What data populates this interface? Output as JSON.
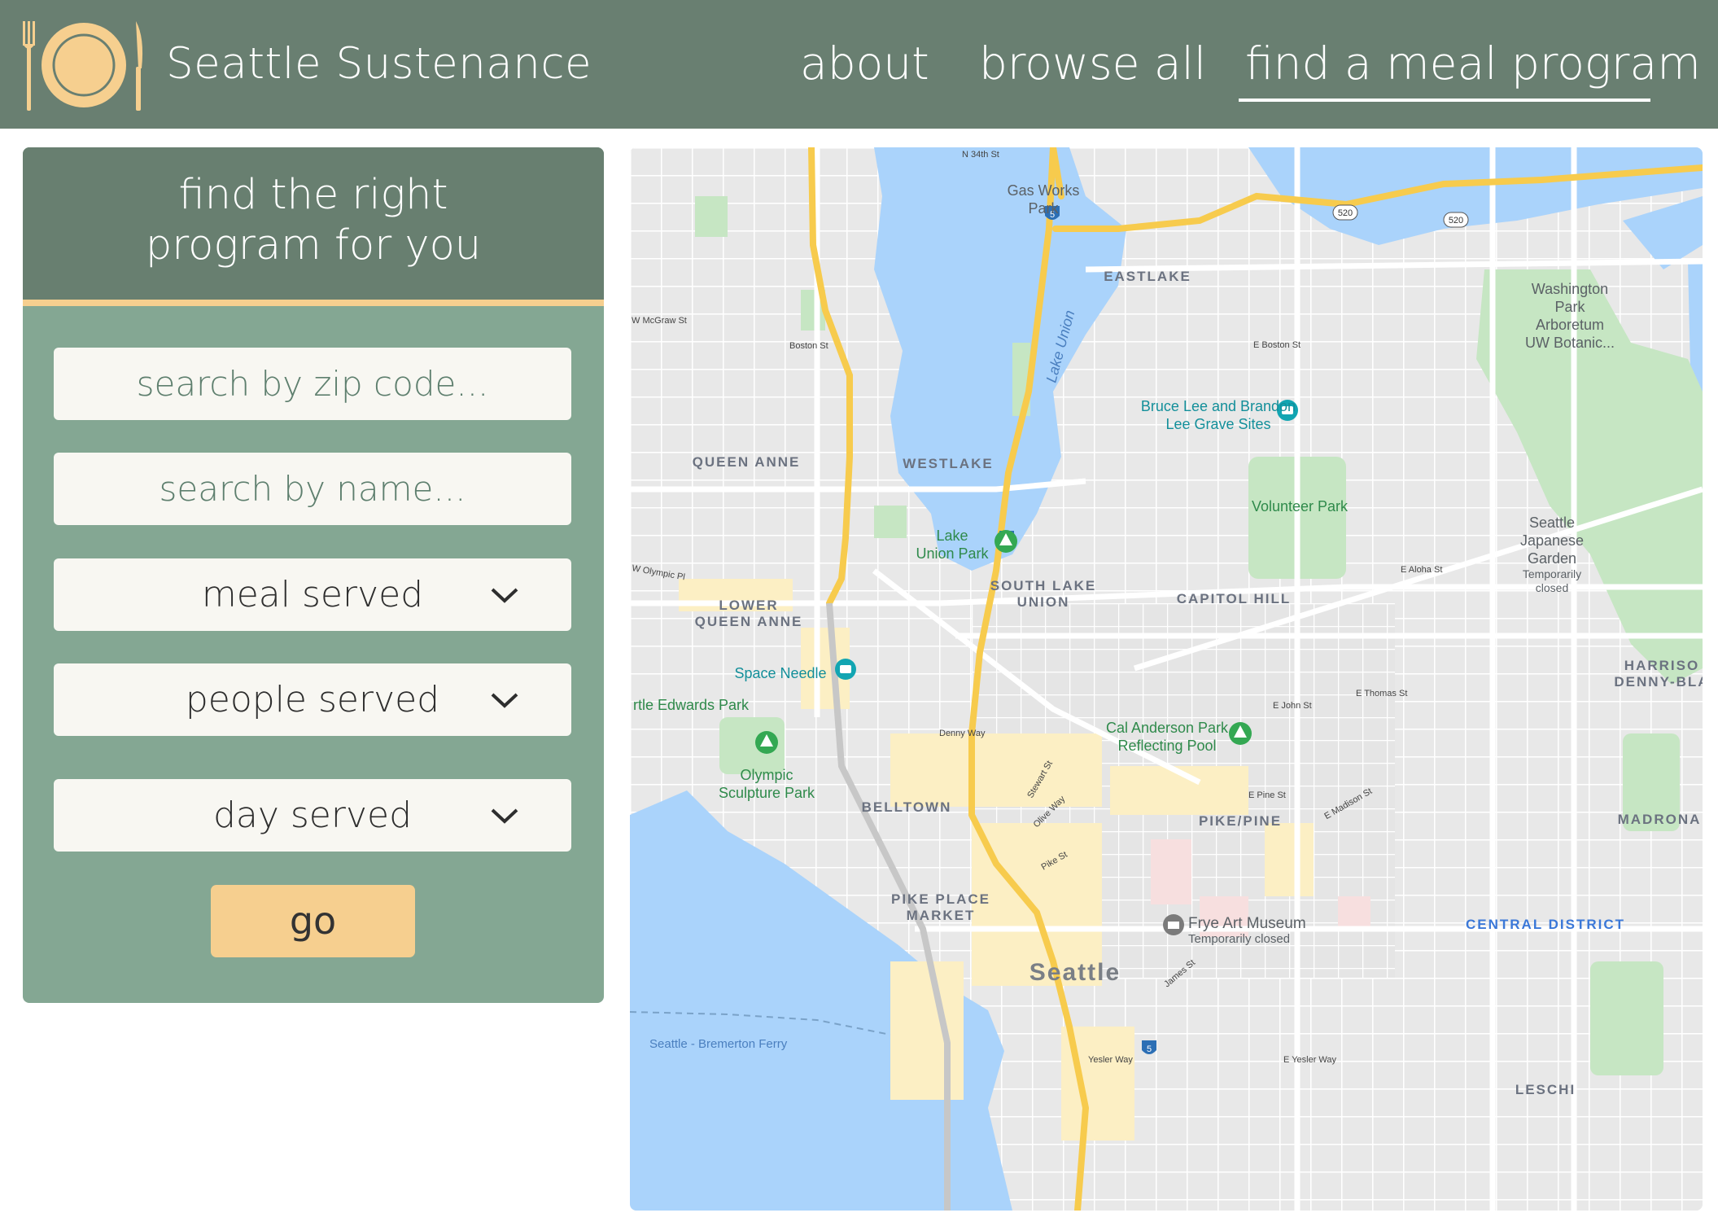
{
  "header": {
    "brand": "Seattle Sustenance",
    "nav": [
      "about",
      "browse all",
      "find a meal program"
    ],
    "active_nav": "find a meal program"
  },
  "panel": {
    "title_line1": "find the right",
    "title_line2": "program for you",
    "zip_placeholder": "search by zip code...",
    "name_placeholder": "search by name...",
    "meal_label": "meal served",
    "people_label": "people served",
    "day_label": "day served",
    "go_label": "go"
  },
  "map": {
    "labels": {
      "n34th": "N 34th St",
      "gasworks1": "Gas Works",
      "gasworks2": "Park",
      "eastlake": "EASTLAKE",
      "lakeunion": "Lake Union",
      "washpark1": "Washington",
      "washpark2": "Park",
      "washpark3": "Arboretum",
      "washpark4": "UW Botanic...",
      "bruce1": "Bruce Lee and Brandon",
      "bruce2": "Lee Grave Sites",
      "queenanne": "QUEEN ANNE",
      "westlake": "WESTLAKE",
      "volunteer": "Volunteer Park",
      "japgarden1": "Seattle",
      "japgarden2": "Japanese",
      "japgarden3": "Garden",
      "japgarden4": "Temporarily",
      "japgarden5": "closed",
      "lakeunionpark1": "Lake",
      "lakeunionpark2": "Union Park",
      "southlake1": "SOUTH LAKE",
      "southlake2": "UNION",
      "capitolhill": "CAPITOL HILL",
      "lowerqa1": "LOWER",
      "lowerqa2": "QUEEN ANNE",
      "spaceneedle": "Space Needle",
      "myrtle": "rtle Edwards Park",
      "harrison1": "HARRISO",
      "harrison2": "DENNY-BLA",
      "calanderson1": "Cal Anderson Park",
      "calanderson2": "Reflecting Pool",
      "olympic1": "Olympic",
      "olympic2": "Sculpture Park",
      "belltown": "BELLTOWN",
      "pikepine": "PIKE/PINE",
      "madrona": "MADRONA",
      "pikeplace1": "PIKE PLACE",
      "pikeplace2": "MARKET",
      "frye1": "Frye Art Museum",
      "frye2": "Temporarily closed",
      "centraldistrict": "CENTRAL DISTRICT",
      "seattle": "Seattle",
      "ferry": "Seattle - Bremerton Ferry",
      "leschi": "LESCHI",
      "bostonst": "Boston St",
      "ebostonst": "E Boston St",
      "wmcgraw": "W McGraw St",
      "ealoha": "E Aloha St",
      "ejohn": "E John St",
      "ethomas": "E Thomas St",
      "epine": "E Pine St",
      "emadison": "E Madison St",
      "dennyway": "Denny Way",
      "yeslerway": "Yesler Way",
      "eyeslerway": "E Yesler Way",
      "wolympic": "W Olympic Pl",
      "pikest": "Pike St",
      "olivewy": "Olive Way",
      "stewartst": "Stewart St",
      "jamesst": "James St",
      "i5": "5",
      "sr520": "520"
    }
  },
  "colors": {
    "header_bg": "#697f71",
    "panel_bg": "#84a793",
    "panel_header_bg": "#687f70",
    "accent": "#f6cf8f",
    "field_bg": "#f8f7f2",
    "water": "#aad3fb",
    "park": "#c6e6c3",
    "highway": "#f7cb4d"
  },
  "icons": [
    "fork-icon",
    "plate-icon",
    "knife-icon",
    "chevron-down-icon",
    "tree-icon",
    "camera-icon",
    "museum-icon"
  ]
}
